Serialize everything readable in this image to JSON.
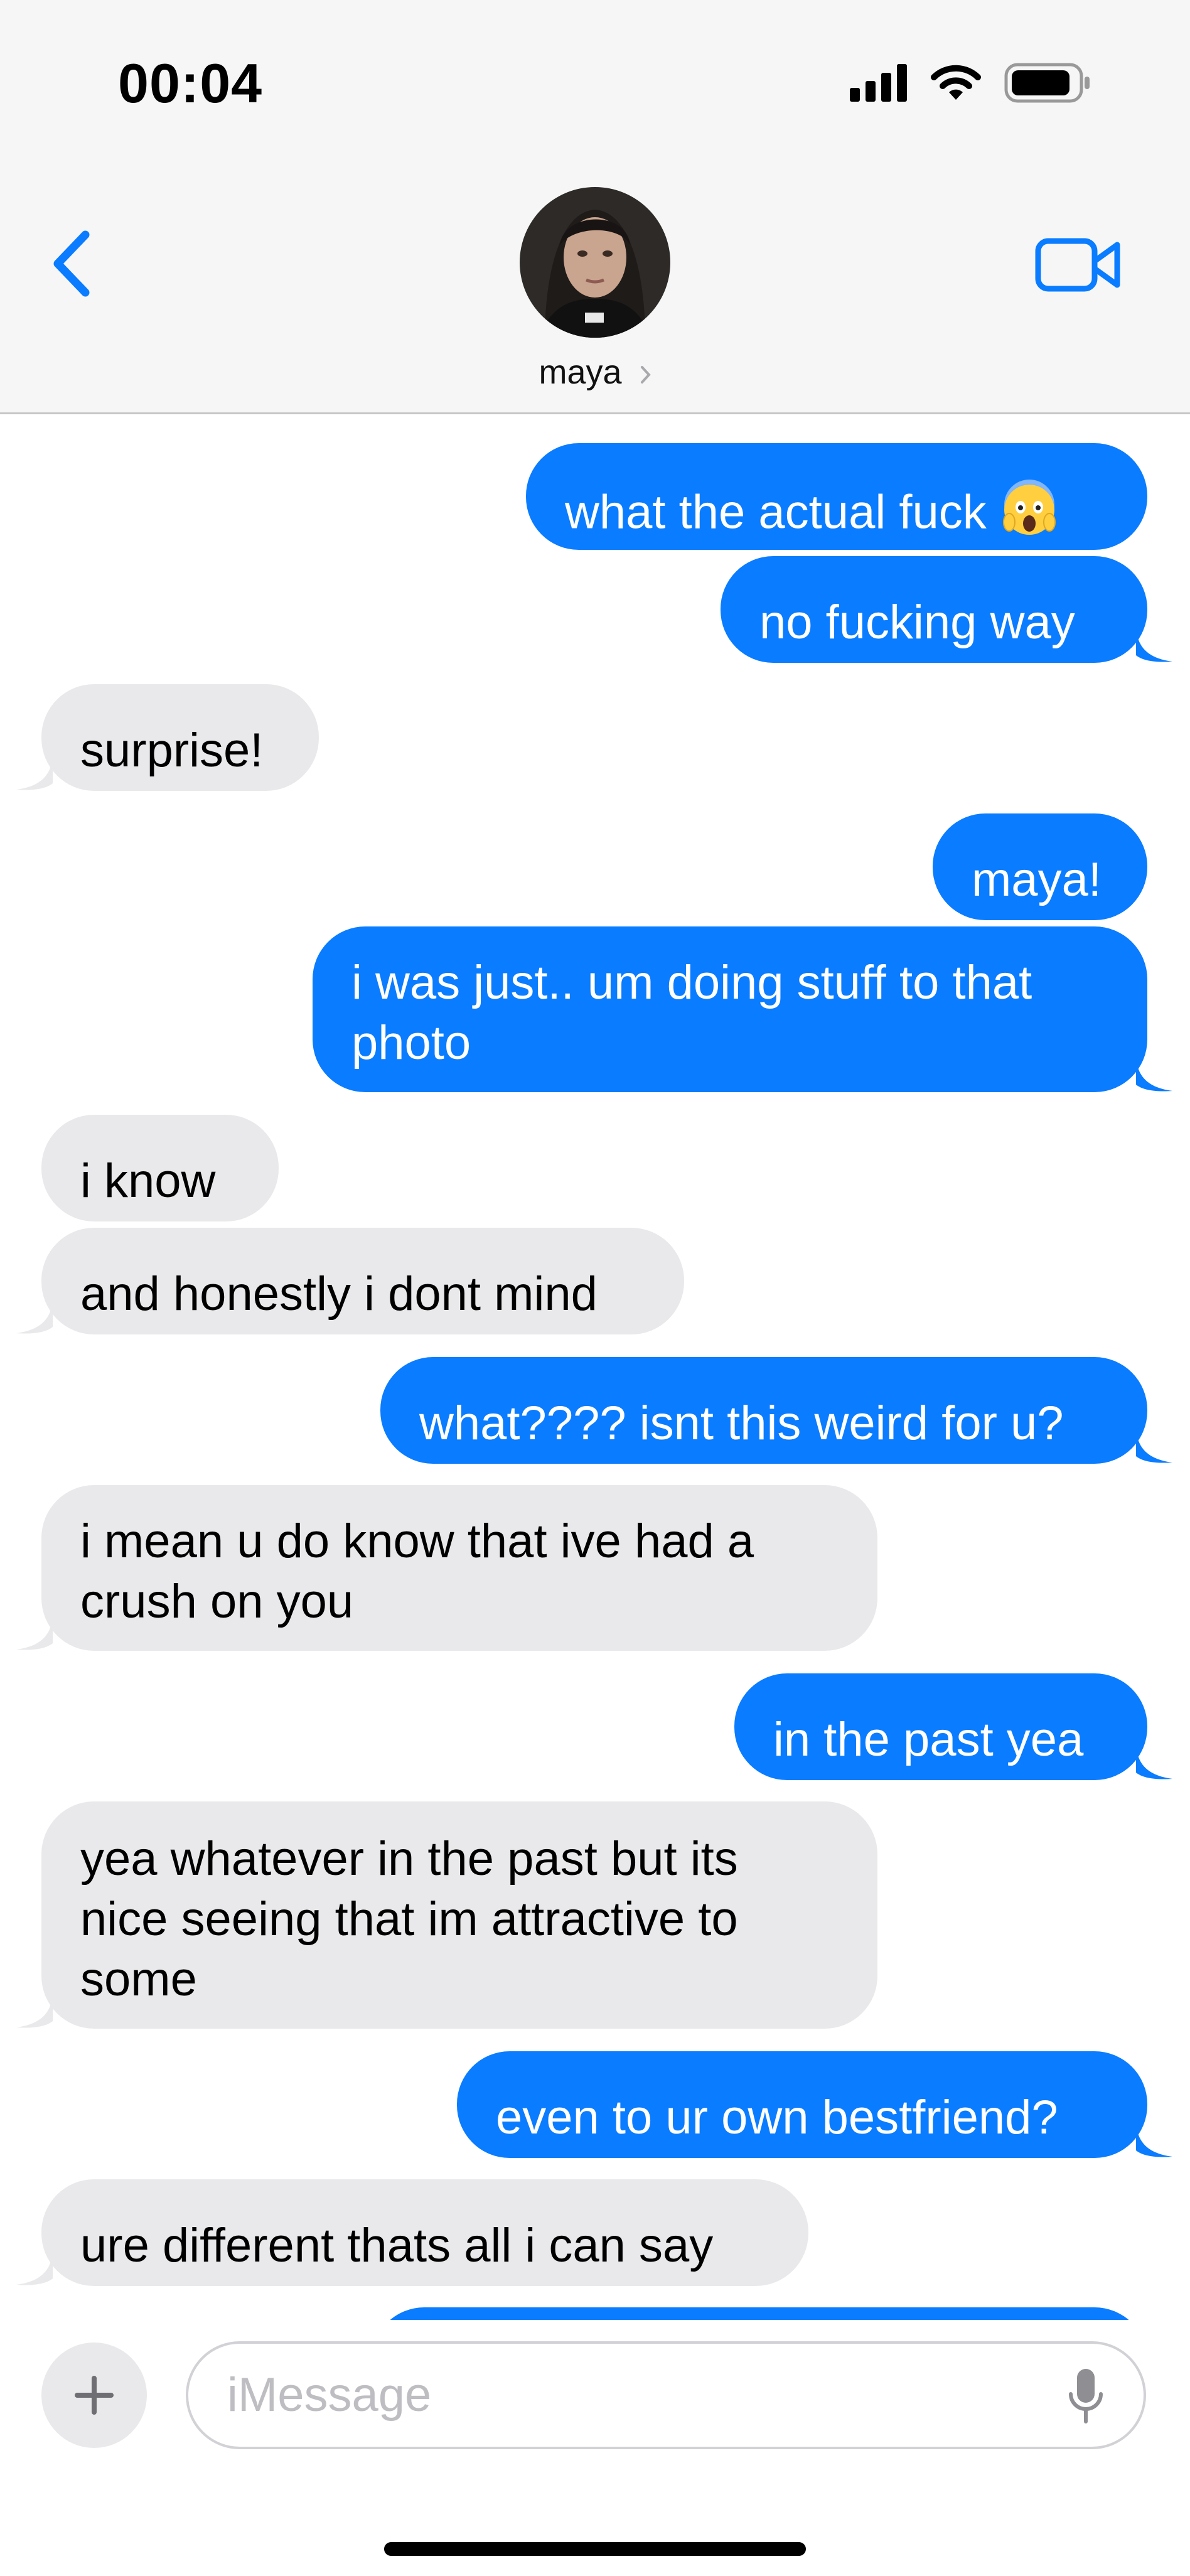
{
  "status_bar": {
    "time": "00:04"
  },
  "header": {
    "contact_name": "maya",
    "back_icon": "chevron-left-icon",
    "video_icon": "video-camera-icon"
  },
  "messages": [
    {
      "side": "sent",
      "text": "what the actual fuck",
      "emoji": "screaming-face-emoji",
      "tail": false
    },
    {
      "side": "sent",
      "text": "no fucking way",
      "tail": true
    },
    {
      "side": "recv",
      "text": "surprise!",
      "tail": true
    },
    {
      "side": "sent",
      "text": "maya!",
      "tail": false
    },
    {
      "side": "sent",
      "text": "i was just.. um doing stuff to that photo",
      "tail": true
    },
    {
      "side": "recv",
      "text": "i know",
      "tail": false
    },
    {
      "side": "recv",
      "text": "and honestly i dont mind",
      "tail": true
    },
    {
      "side": "sent",
      "text": "what???? isnt this weird for u?",
      "tail": true
    },
    {
      "side": "recv",
      "text": "i mean u do know that ive had a crush on you",
      "tail": true
    },
    {
      "side": "sent",
      "text": "in the past yea",
      "tail": true
    },
    {
      "side": "recv",
      "text": "yea whatever in the past but its nice seeing that im attractive to some",
      "tail": true
    },
    {
      "side": "sent",
      "text": "even to ur own bestfriend?",
      "tail": true
    },
    {
      "side": "recv",
      "text": "ure different thats all i can say",
      "tail": true
    },
    {
      "side": "sent",
      "text": "",
      "tail": false
    }
  ],
  "composer": {
    "placeholder": "iMessage"
  },
  "colors": {
    "sent_bubble": "#0a7cff",
    "received_bubble": "#e9e9eb",
    "accent": "#0a7cff"
  }
}
